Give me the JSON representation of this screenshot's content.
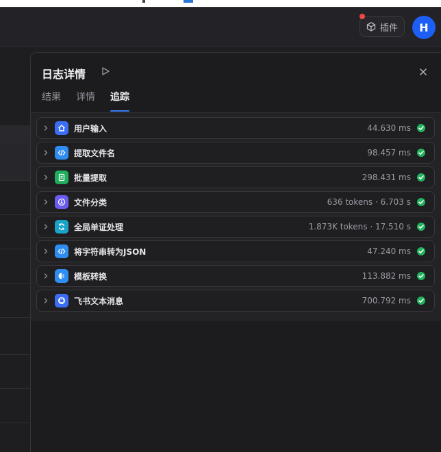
{
  "header": {
    "plugin_label": "插件",
    "avatar_letter": "H"
  },
  "panel": {
    "title": "日志详情",
    "tabs": [
      {
        "label": "结果",
        "active": false
      },
      {
        "label": "详情",
        "active": false
      },
      {
        "label": "追踪",
        "active": true
      }
    ],
    "nodes": [
      {
        "label": "用户输入",
        "stat": "44.630 ms",
        "icon": "home-icon",
        "color": "#3b6df5"
      },
      {
        "label": "提取文件名",
        "stat": "98.457 ms",
        "icon": "code-icon",
        "color": "#2f8cf0"
      },
      {
        "label": "批量提取",
        "stat": "298.431 ms",
        "icon": "document-icon",
        "color": "#1fae5b"
      },
      {
        "label": "文件分类",
        "stat": "636 tokens · 6.703 s",
        "icon": "classify-icon",
        "color": "#6b5cf0"
      },
      {
        "label": "全局单证处理",
        "stat": "1.873K tokens · 17.510 s",
        "icon": "loop-icon",
        "color": "#19a3c9"
      },
      {
        "label": "将字符串转为JSON",
        "stat": "47.240 ms",
        "icon": "code-icon",
        "color": "#2f8cf0"
      },
      {
        "label": "模板转换",
        "stat": "113.882 ms",
        "icon": "template-icon",
        "color": "#2f8cf0"
      },
      {
        "label": "飞书文本消息",
        "stat": "700.792 ms",
        "icon": "message-icon",
        "color": "#3b6df5"
      }
    ]
  },
  "colors": {
    "accent": "#3b7cf6",
    "success": "#22b35e",
    "notify": "#ef4646"
  }
}
